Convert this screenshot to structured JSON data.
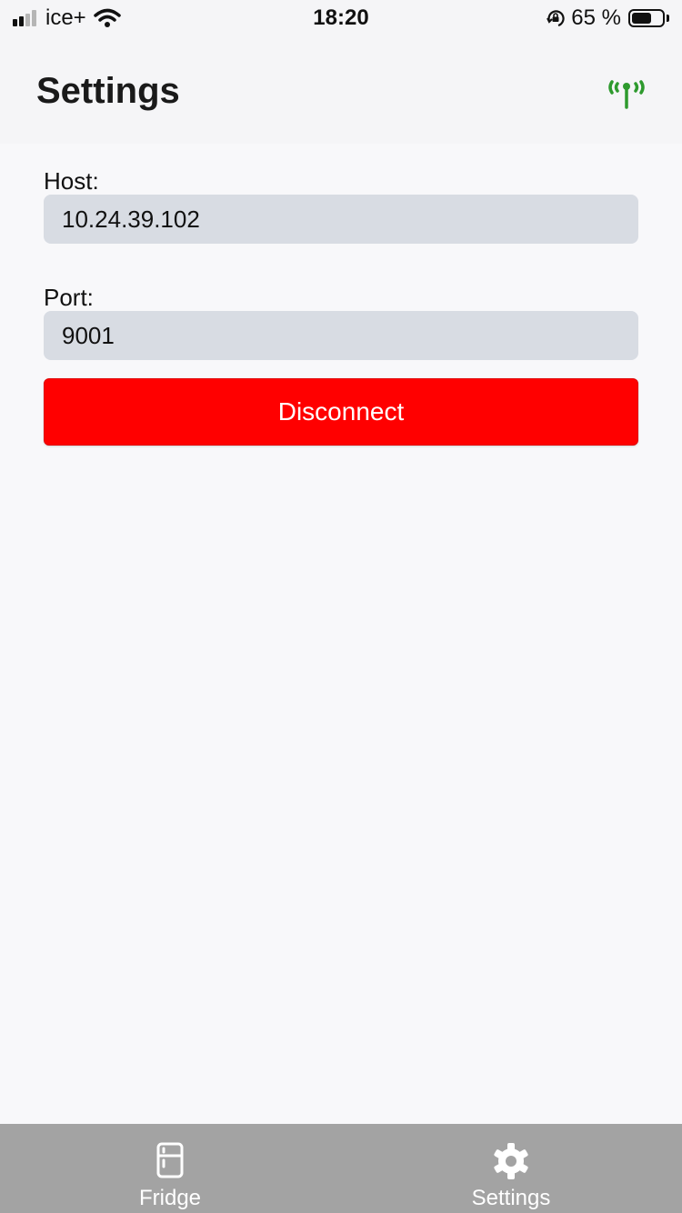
{
  "status_bar": {
    "carrier": "ice+",
    "time": "18:20",
    "battery_percent": "65 %",
    "battery_level": 0.65,
    "signal_bars_active": 2,
    "signal_bars_total": 4
  },
  "header": {
    "title": "Settings",
    "connection_icon": "antenna-icon",
    "connection_color": "#2e9a2e"
  },
  "form": {
    "host_label": "Host:",
    "host_value": "10.24.39.102",
    "port_label": "Port:",
    "port_value": "9001",
    "disconnect_label": "Disconnect",
    "disconnect_color": "#ff0000"
  },
  "tab_bar": {
    "items": [
      {
        "label": "Fridge",
        "icon": "fridge-icon"
      },
      {
        "label": "Settings",
        "icon": "gear-icon"
      }
    ]
  }
}
